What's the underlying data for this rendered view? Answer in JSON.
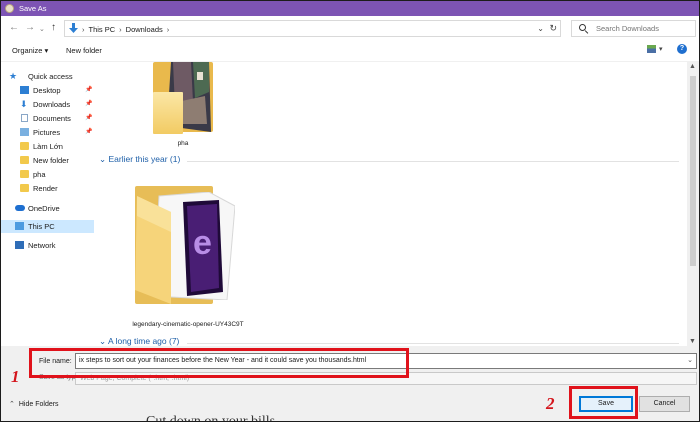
{
  "window": {
    "title": "Save As"
  },
  "address": {
    "crumbs": [
      "This PC",
      "Downloads"
    ]
  },
  "search": {
    "placeholder": "Search Downloads"
  },
  "toolbar": {
    "organize": "Organize ▾",
    "new_folder": "New folder",
    "help": "?"
  },
  "sidebar": {
    "items": [
      {
        "label": "Quick access",
        "icon": "star-icon"
      },
      {
        "label": "Desktop",
        "icon": "desktop-icon",
        "pinned": true
      },
      {
        "label": "Downloads",
        "icon": "download-icon",
        "pinned": true
      },
      {
        "label": "Documents",
        "icon": "documents-icon",
        "pinned": true
      },
      {
        "label": "Pictures",
        "icon": "pictures-icon",
        "pinned": true
      },
      {
        "label": "Làm Lớn",
        "icon": "folder-icon"
      },
      {
        "label": "New folder",
        "icon": "folder-icon"
      },
      {
        "label": "pha",
        "icon": "folder-icon"
      },
      {
        "label": "Render",
        "icon": "folder-icon"
      },
      {
        "label": "OneDrive",
        "icon": "onedrive-icon"
      },
      {
        "label": "This PC",
        "icon": "this-pc-icon",
        "selected": true
      },
      {
        "label": "Network",
        "icon": "network-icon"
      }
    ]
  },
  "content": {
    "groups": [
      {
        "header": "Earlier this year (1)"
      },
      {
        "header": "A long time ago (7)"
      }
    ],
    "items": [
      {
        "name": "pha"
      },
      {
        "name": "legendary-cinematic-opener-UY43C9T"
      }
    ]
  },
  "form": {
    "file_name_label": "File name:",
    "file_name_value": "ix steps to sort out your finances before the New Year - and it could save you thousands.html",
    "save_type_label": "Save as type:",
    "save_type_value": "Web Page, Complete (*.htm;*.html)"
  },
  "footer": {
    "hide_folders": "Hide Folders",
    "save": "Save",
    "cancel": "Cancel",
    "background_text": "Cut down on your bills"
  },
  "annotations": {
    "step1": "1",
    "step2": "2"
  },
  "colors": {
    "titlebar": "#7d54b4",
    "annotation_red": "#e0121b",
    "link_blue": "#1e5fa8",
    "selected": "#cce8ff"
  }
}
